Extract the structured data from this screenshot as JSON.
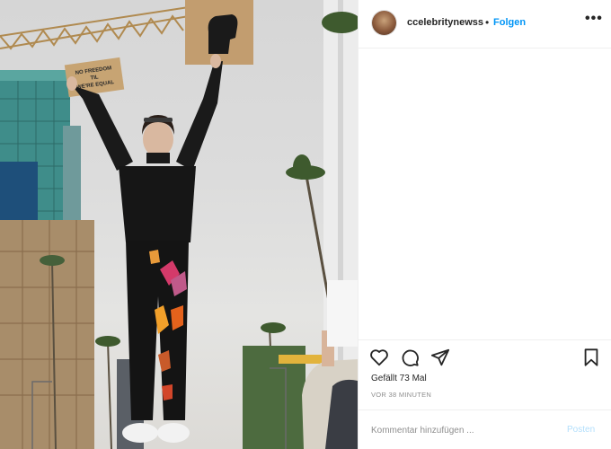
{
  "post": {
    "photo_alt": "Protester standing with raised arms holding signs",
    "sign_left_text": "NO FREEDOM TIL WE'RE EQUAL"
  },
  "header": {
    "username": "ccelebritynewss",
    "separator": "•",
    "follow_label": "Folgen",
    "more_label": "•••"
  },
  "actions": {
    "like_icon": "heart-icon",
    "comment_icon": "comment-icon",
    "share_icon": "send-icon",
    "save_icon": "bookmark-icon"
  },
  "stats": {
    "likes_text": "Gefällt 73 Mal",
    "time_text": "VOR 38 MINUTEN"
  },
  "comment": {
    "placeholder": "Kommentar hinzufügen ...",
    "post_label": "Posten"
  },
  "colors": {
    "accent": "#0095f6",
    "post_disabled": "#b2dffc",
    "muted": "#8e8e8e"
  }
}
